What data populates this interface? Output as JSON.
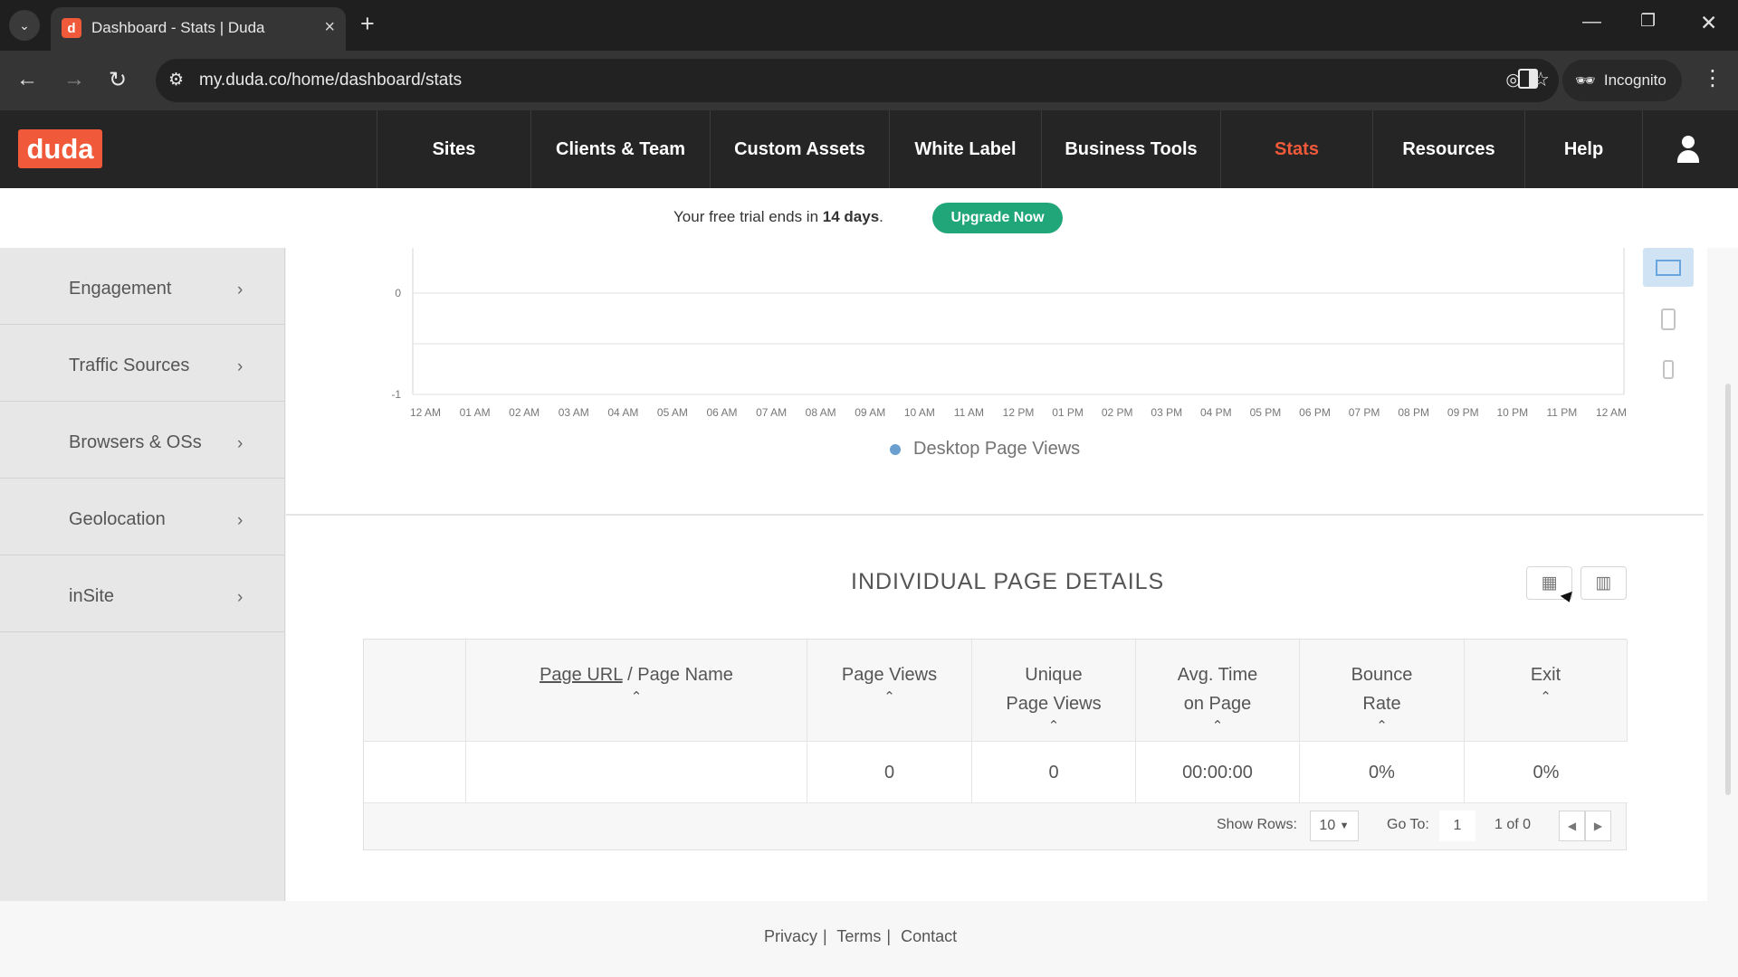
{
  "browser": {
    "tab_title": "Dashboard - Stats | Duda",
    "url": "my.duda.co/home/dashboard/stats",
    "incognito_label": "Incognito"
  },
  "app": {
    "logo": "duda",
    "nav": [
      {
        "label": "Sites"
      },
      {
        "label": "Clients & Team"
      },
      {
        "label": "Custom Assets"
      },
      {
        "label": "White Label"
      },
      {
        "label": "Business Tools"
      },
      {
        "label": "Stats",
        "active": true
      },
      {
        "label": "Resources"
      },
      {
        "label": "Help"
      }
    ]
  },
  "trial": {
    "prefix": "Your free trial ends in",
    "days": "14 days",
    "suffix": ".",
    "button": "Upgrade Now"
  },
  "sidebar": {
    "items": [
      {
        "label": "Engagement"
      },
      {
        "label": "Traffic Sources"
      },
      {
        "label": "Browsers & OSs"
      },
      {
        "label": "Geolocation"
      },
      {
        "label": "inSite"
      }
    ]
  },
  "chart_data": {
    "type": "line",
    "x": [
      "12 AM",
      "01 AM",
      "02 AM",
      "03 AM",
      "04 AM",
      "05 AM",
      "06 AM",
      "07 AM",
      "08 AM",
      "09 AM",
      "10 AM",
      "11 AM",
      "12 PM",
      "01 PM",
      "02 PM",
      "03 PM",
      "04 PM",
      "05 PM",
      "06 PM",
      "07 PM",
      "08 PM",
      "09 PM",
      "10 PM",
      "11 PM",
      "12 AM"
    ],
    "y_ticks": [
      "0",
      "-1"
    ],
    "series": [
      {
        "name": "Desktop Page Views",
        "values": [
          0,
          0,
          0,
          0,
          0,
          0,
          0,
          0,
          0,
          0,
          0,
          0,
          0,
          0,
          0,
          0,
          0,
          0,
          0,
          0,
          0,
          0,
          0,
          0,
          0
        ]
      }
    ],
    "legend": "bottom-center",
    "grid": true,
    "colors": {
      "series": "#6a9fcf"
    }
  },
  "details": {
    "title": "INDIVIDUAL PAGE DETAILS",
    "columns": {
      "page_url": "Page URL",
      "separator": " / ",
      "page_name": "Page Name",
      "page_views": "Page Views",
      "unique_views_1": "Unique",
      "unique_views_2": "Page Views",
      "avg_time_1": "Avg. Time",
      "avg_time_2": "on Page",
      "bounce_1": "Bounce",
      "bounce_2": "Rate",
      "exit": "Exit"
    },
    "row": {
      "url": "",
      "page_views": "0",
      "unique_page_views": "0",
      "avg_time": "00:00:00",
      "bounce_rate": "0%",
      "exit": "0%"
    },
    "pager": {
      "show_rows_label": "Show Rows:",
      "rows_value": "10",
      "goto_label": "Go To:",
      "goto_value": "1",
      "page_info": "1 of 0"
    }
  },
  "footer": {
    "privacy": "Privacy",
    "terms": "Terms",
    "contact": "Contact"
  },
  "colors": {
    "brand": "#f05a3a",
    "upgrade": "#21a67a",
    "nav_bg": "#252525"
  }
}
